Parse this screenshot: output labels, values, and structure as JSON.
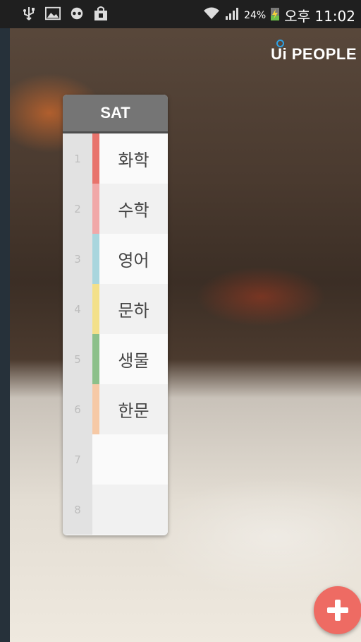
{
  "status_bar": {
    "battery_percent": "24%",
    "time": "오후 11:02",
    "left_icons": [
      "usb-icon",
      "image-icon",
      "notification-icon",
      "bag-icon"
    ],
    "right_icons": [
      "wifi-icon",
      "signal-icon",
      "battery-charging-icon"
    ]
  },
  "brand": {
    "logo": "Ui PEOPLE"
  },
  "timetable": {
    "day": "SAT",
    "periods": [
      {
        "num": "1",
        "subject": "화학",
        "color": "#e8736c"
      },
      {
        "num": "2",
        "subject": "수학",
        "color": "#f1a8a8"
      },
      {
        "num": "3",
        "subject": "영어",
        "color": "#a9d6de"
      },
      {
        "num": "4",
        "subject": "문하",
        "color": "#f3e08a"
      },
      {
        "num": "5",
        "subject": "생물",
        "color": "#8cc08a"
      },
      {
        "num": "6",
        "subject": "한문",
        "color": "#f6c9a6"
      },
      {
        "num": "7",
        "subject": "",
        "color": ""
      },
      {
        "num": "8",
        "subject": "",
        "color": ""
      }
    ]
  },
  "fab": {
    "icon": "plus-icon",
    "color": "#ee6b63"
  }
}
